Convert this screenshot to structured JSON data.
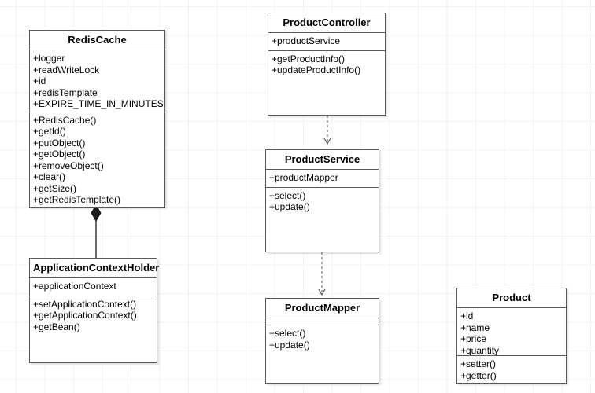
{
  "diagram": {
    "title": "UML Class Diagram",
    "type": "uml-class-diagram",
    "background": "#ffffff",
    "grid_color": "#f2f2f2",
    "line_color": "#595959",
    "text_color": "#000000"
  },
  "classes": {
    "redis_cache": {
      "name": "RedisCache",
      "attributes": [
        "+logger",
        "+readWriteLock",
        "+id",
        "+redisTemplate",
        "+EXPIRE_TIME_IN_MINUTES"
      ],
      "operations": [
        "+RedisCache()",
        "+getId()",
        "+putObject()",
        "+getObject()",
        "+removeObject()",
        "+clear()",
        "+getSize()",
        "+getRedisTemplate()"
      ]
    },
    "application_context_holder": {
      "name": "ApplicationContextHolder",
      "attributes": [
        "+applicationContext"
      ],
      "operations": [
        "+setApplicationContext()",
        "+getApplicationContext()",
        "+getBean()"
      ]
    },
    "product_controller": {
      "name": "ProductController",
      "attributes": [
        "+productService"
      ],
      "operations": [
        "+getProductInfo()",
        "+updateProductInfo()"
      ]
    },
    "product_service": {
      "name": "ProductService",
      "attributes": [
        "+productMapper"
      ],
      "operations": [
        "+select()",
        "+update()"
      ]
    },
    "product_mapper": {
      "name": "ProductMapper",
      "attributes": [],
      "operations": [
        "+select()",
        "+update()"
      ]
    },
    "product": {
      "name": "Product",
      "attributes": [
        "+id",
        "+name",
        "+price",
        "+quantity"
      ],
      "operations": [
        "+setter()",
        "+getter()"
      ]
    }
  },
  "relationships": [
    {
      "id": "composition-appcontextholder-redischache",
      "kind": "composition",
      "source": "application_context_holder",
      "target": "redis_cache",
      "style": "solid",
      "marker": "filled-diamond"
    },
    {
      "id": "dependency-controller-service",
      "kind": "dependency",
      "source": "product_controller",
      "target": "product_service",
      "style": "dashed",
      "marker": "open-arrow"
    },
    {
      "id": "dependency-service-mapper",
      "kind": "dependency",
      "source": "product_service",
      "target": "product_mapper",
      "style": "dashed",
      "marker": "open-arrow"
    }
  ]
}
